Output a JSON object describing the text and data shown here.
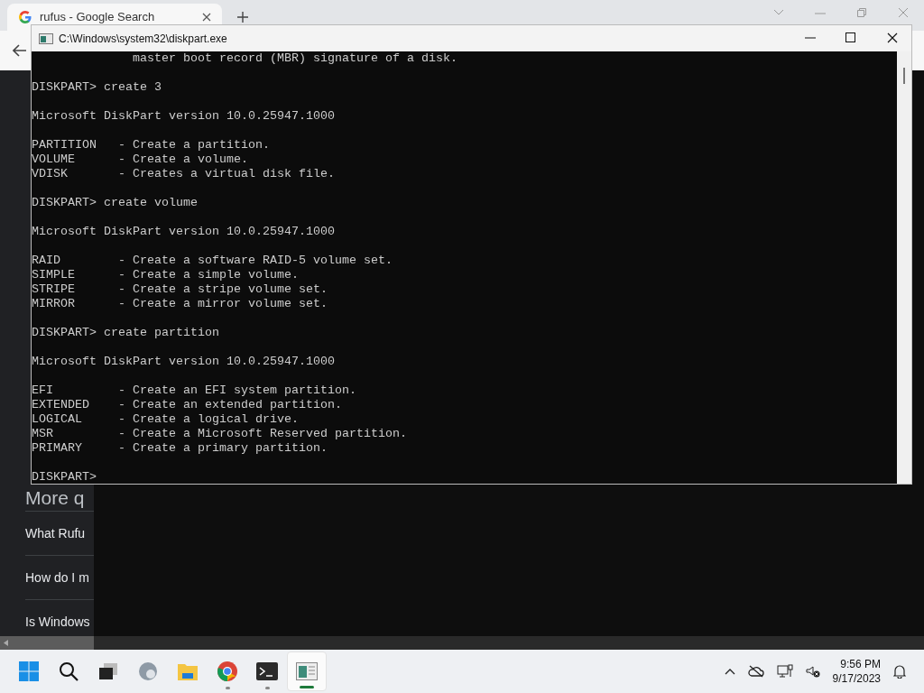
{
  "browser": {
    "tab": {
      "title": "rufus - Google Search"
    },
    "page_items": [
      {
        "kind": "heading",
        "text": "More q"
      },
      {
        "kind": "question",
        "text": "What Rufu"
      },
      {
        "kind": "question",
        "text": "How do I m"
      },
      {
        "kind": "question",
        "text": "Is Windows"
      }
    ]
  },
  "console": {
    "title": "C:\\Windows\\system32\\diskpart.exe",
    "blocks": [
      [
        "              master boot record (MBR) signature of a disk."
      ],
      [
        "DISKPART> create 3"
      ],
      [
        "Microsoft DiskPart version 10.0.25947.1000"
      ],
      [
        "PARTITION   - Create a partition.",
        "VOLUME      - Create a volume.",
        "VDISK       - Creates a virtual disk file."
      ],
      [
        "DISKPART> create volume"
      ],
      [
        "Microsoft DiskPart version 10.0.25947.1000"
      ],
      [
        "RAID        - Create a software RAID-5 volume set.",
        "SIMPLE      - Create a simple volume.",
        "STRIPE      - Create a stripe volume set.",
        "MIRROR      - Create a mirror volume set."
      ],
      [
        "DISKPART> create partition"
      ],
      [
        "Microsoft DiskPart version 10.0.25947.1000"
      ],
      [
        "EFI         - Create an EFI system partition.",
        "EXTENDED    - Create an extended partition.",
        "LOGICAL     - Create a logical drive.",
        "MSR         - Create a Microsoft Reserved partition.",
        "PRIMARY     - Create a primary partition."
      ],
      [
        "DISKPART> "
      ]
    ]
  },
  "taskbar": {
    "apps": [
      {
        "kind": "start",
        "running": false,
        "selected": false
      },
      {
        "kind": "search",
        "running": false,
        "selected": false
      },
      {
        "kind": "task-view",
        "running": false,
        "selected": false
      },
      {
        "kind": "edge",
        "running": false,
        "selected": false
      },
      {
        "kind": "files",
        "running": false,
        "selected": false
      },
      {
        "kind": "chrome",
        "running": true,
        "selected": false
      },
      {
        "kind": "terminal",
        "running": true,
        "selected": false
      },
      {
        "kind": "diskpart",
        "running": true,
        "selected": true
      }
    ],
    "clock": {
      "time": "9:56 PM",
      "date": "9/17/2023"
    }
  }
}
